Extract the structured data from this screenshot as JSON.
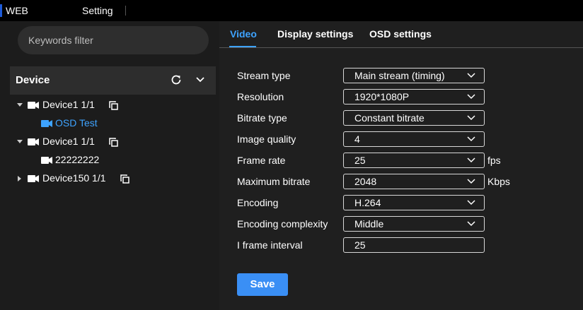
{
  "topbar": {
    "app_label": "WEB",
    "menu_setting": "Setting"
  },
  "sidebar": {
    "search_placeholder": "Keywords filter",
    "device_title": "Device",
    "tree": [
      {
        "label": "Device1 1/1",
        "expanded": true,
        "children": [
          {
            "label": "OSD Test",
            "selected": true
          }
        ]
      },
      {
        "label": "Device1 1/1",
        "expanded": true,
        "children": [
          {
            "label": "22222222",
            "selected": false
          }
        ]
      },
      {
        "label": "Device150 1/1",
        "expanded": false,
        "children": []
      }
    ]
  },
  "tabs": [
    {
      "label": "Video",
      "active": true
    },
    {
      "label": "Display settings",
      "active": false
    },
    {
      "label": "OSD settings",
      "active": false
    }
  ],
  "form": {
    "stream_type": {
      "label": "Stream type",
      "value": "Main stream (timing)"
    },
    "resolution": {
      "label": "Resolution",
      "value": "1920*1080P"
    },
    "bitrate_type": {
      "label": "Bitrate type",
      "value": "Constant bitrate"
    },
    "image_quality": {
      "label": "Image quality",
      "value": "4"
    },
    "frame_rate": {
      "label": "Frame rate",
      "value": "25",
      "unit": "fps"
    },
    "max_bitrate": {
      "label": "Maximum bitrate",
      "value": "2048",
      "unit": "Kbps"
    },
    "encoding": {
      "label": "Encoding",
      "value": "H.264"
    },
    "encoding_complexity": {
      "label": "Encoding complexity",
      "value": "Middle"
    },
    "i_frame_interval": {
      "label": "I frame interval",
      "value": "25"
    }
  },
  "save_label": "Save",
  "colors": {
    "accent": "#3ea3ff",
    "button": "#3a8ff5",
    "background": "#1f1f1f",
    "topbar": "#000000"
  }
}
